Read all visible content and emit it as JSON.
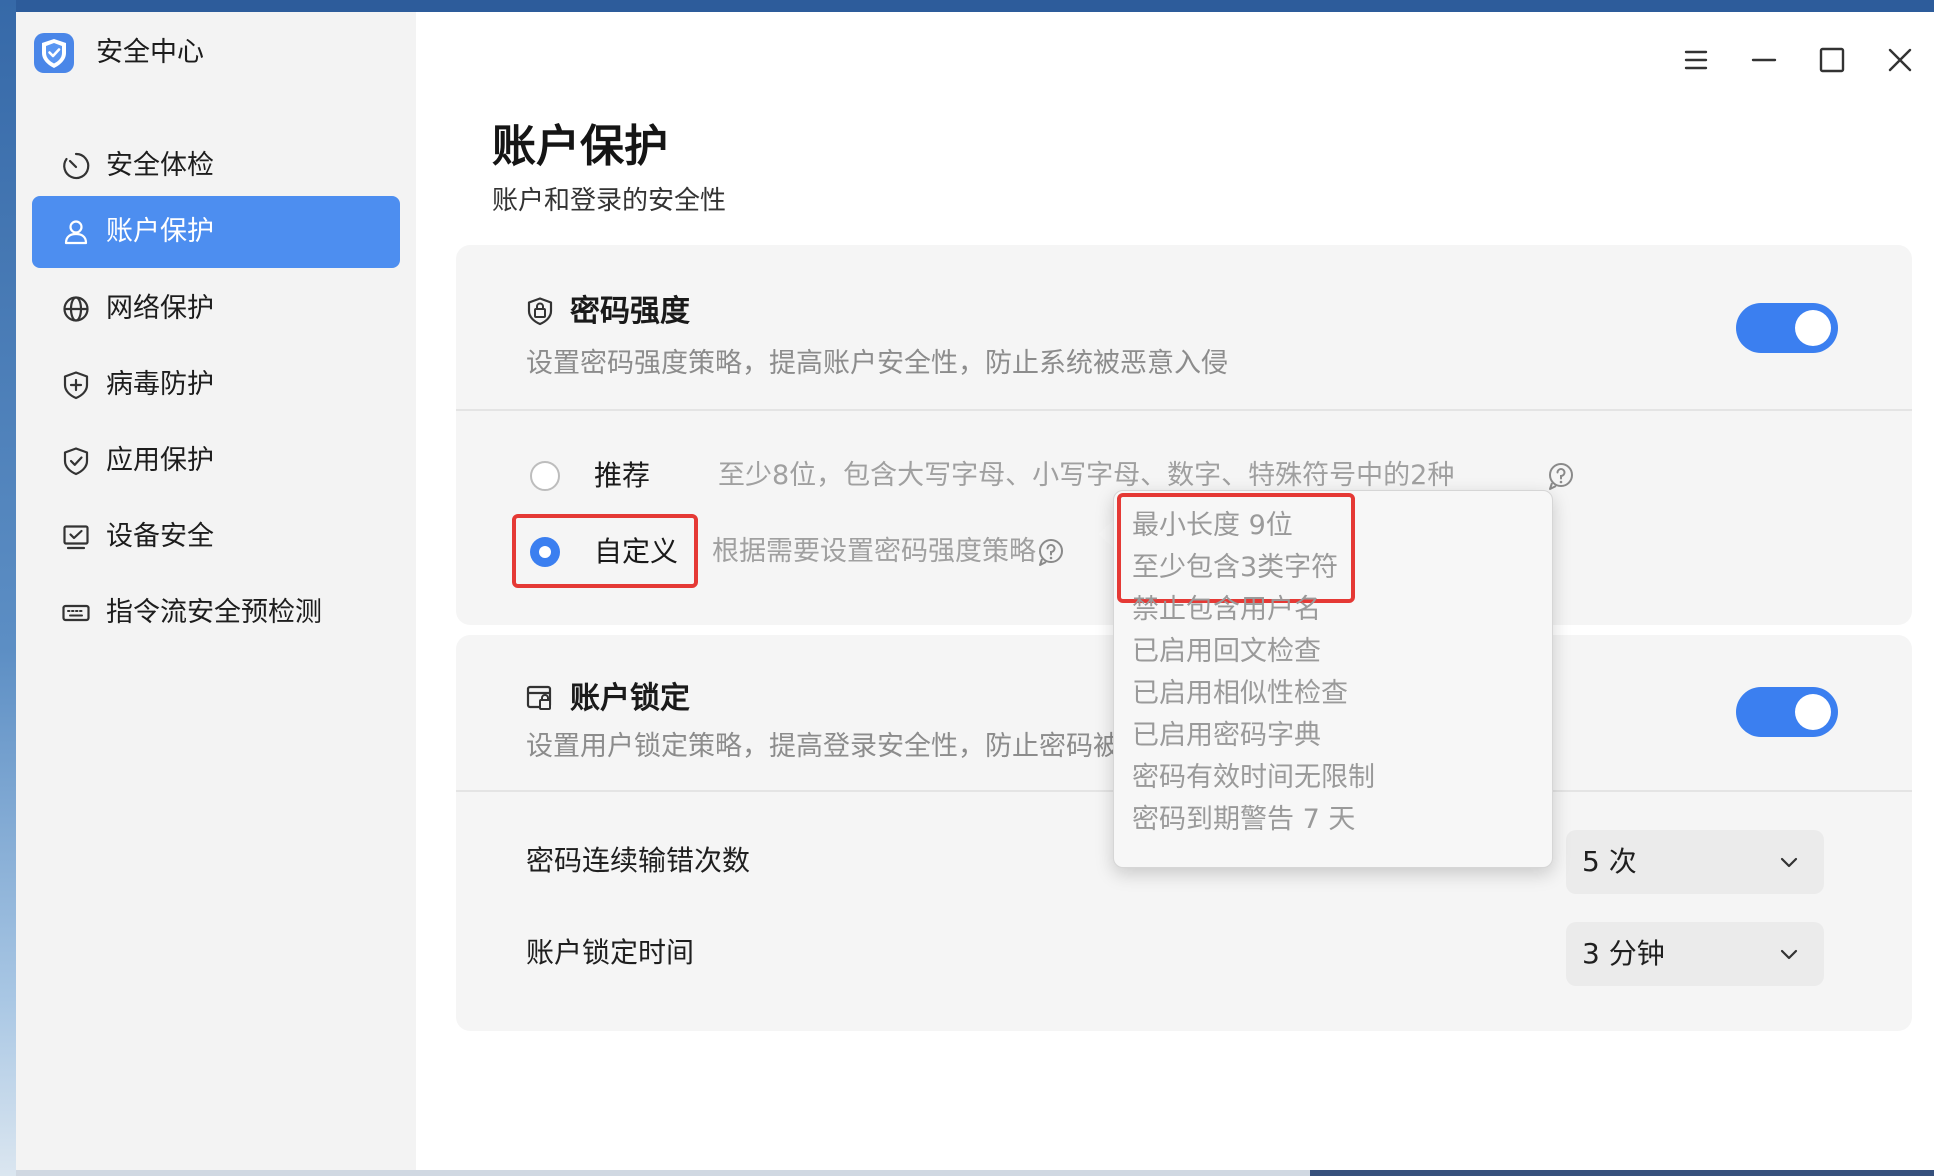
{
  "app": {
    "title": "安全中心",
    "logo_icon": "shield-logo-icon"
  },
  "window_controls": {
    "menu_icon": "menu-icon",
    "minimize_icon": "minimize-icon",
    "maximize_icon": "maximize-icon",
    "close_icon": "close-icon"
  },
  "sidebar": {
    "items": [
      {
        "label": "安全体检",
        "icon": "checkup-icon"
      },
      {
        "label": "账户保护",
        "icon": "user-icon",
        "active": true
      },
      {
        "label": "网络保护",
        "icon": "globe-icon"
      },
      {
        "label": "病毒防护",
        "icon": "shield-plus-icon"
      },
      {
        "label": "应用保护",
        "icon": "shield-check-icon"
      },
      {
        "label": "设备安全",
        "icon": "device-check-icon"
      },
      {
        "label": "指令流安全预检测",
        "icon": "keyboard-icon"
      }
    ]
  },
  "page": {
    "title": "账户保护",
    "subtitle": "账户和登录的安全性"
  },
  "password_strength": {
    "title": "密码强度",
    "icon": "password-shield-icon",
    "description": "设置密码强度策略，提高账户安全性，防止系统被恶意入侵",
    "enabled": true,
    "options": [
      {
        "label": "推荐",
        "description": "至少8位，包含大写字母、小写字母、数字、特殊符号中的2种",
        "selected": false
      },
      {
        "label": "自定义",
        "description": "根据需要设置密码强度策略",
        "selected": true
      }
    ]
  },
  "policy_popup": {
    "lines": [
      "最小长度 9位",
      "至少包含3类字符",
      "禁止包含用户名",
      "已启用回文检查",
      "已启用相似性检查",
      "已启用密码字典",
      "密码有效时间无限制",
      "密码到期警告 7 天"
    ]
  },
  "account_lock": {
    "title": "账户锁定",
    "icon": "lock-card-icon",
    "description": "设置用户锁定策略，提高登录安全性，防止密码被",
    "enabled": true,
    "rows": [
      {
        "label": "密码连续输错次数",
        "value": "5 次"
      },
      {
        "label": "账户锁定时间",
        "value": "3 分钟"
      }
    ]
  },
  "colors": {
    "accent": "#3b7ff0",
    "sidebar_active": "#4d8ef0",
    "highlight": "#e53935"
  }
}
